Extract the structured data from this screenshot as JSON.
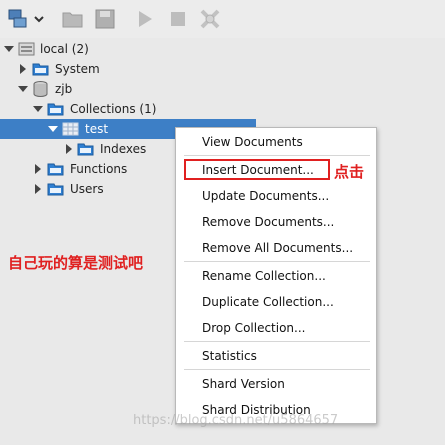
{
  "toolbar": {
    "buttons": [
      {
        "icon": "connect-icon"
      },
      {
        "icon": "open-folder-icon"
      },
      {
        "icon": "save-icon"
      },
      {
        "icon": "run-icon"
      },
      {
        "icon": "stop-icon"
      },
      {
        "icon": "explain-icon"
      }
    ]
  },
  "tree": {
    "local": "local (2)",
    "system": "System",
    "zjb": "zjb",
    "collections": "Collections (1)",
    "test": "test",
    "indexes": "Indexes",
    "functions": "Functions",
    "users": "Users"
  },
  "context_menu": {
    "view_documents": "View Documents",
    "insert_document": "Insert Document...",
    "update_documents": "Update Documents...",
    "remove_documents": "Remove Documents...",
    "remove_all_documents": "Remove All Documents...",
    "rename_collection": "Rename Collection...",
    "duplicate_collection": "Duplicate Collection...",
    "drop_collection": "Drop Collection...",
    "statistics": "Statistics",
    "shard_version": "Shard Version",
    "shard_distribution": "Shard Distribution"
  },
  "annotations": {
    "click_note": "点击",
    "side_note": "自己玩的算是测试吧"
  },
  "watermark": "https://blog.csdn.net/u5864657",
  "colors": {
    "selection": "#3d7fc6",
    "folder": "#2f7fd1",
    "annotation_red": "#e02020"
  }
}
